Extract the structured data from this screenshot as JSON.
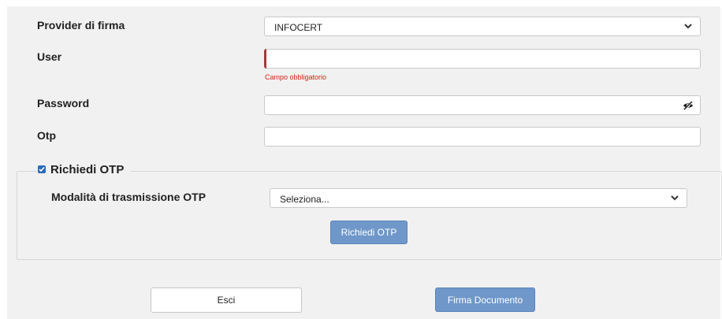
{
  "form": {
    "provider": {
      "label": "Provider di firma",
      "value": "INFOCERT"
    },
    "user": {
      "label": "User",
      "value": "",
      "error": "Campo obbligatorio"
    },
    "password": {
      "label": "Password",
      "value": ""
    },
    "otp": {
      "label": "Otp",
      "value": ""
    }
  },
  "otp_request": {
    "checkbox_label": "Richiedi OTP",
    "checked": true,
    "mode_label": "Modalità di trasmissione OTP",
    "mode_value": "Seleziona...",
    "request_button": "Richiedi OTP"
  },
  "actions": {
    "exit_button": "Esci",
    "sign_button": "Firma Documento"
  },
  "colors": {
    "primary_button": "#6f97c9",
    "error": "#d9201a",
    "panel_bg": "#f1f1f1"
  },
  "icons": {
    "chevron": "chevron-down-icon",
    "password_toggle": "eye-slash-icon",
    "checkbox": "checkbox-checked-icon"
  }
}
